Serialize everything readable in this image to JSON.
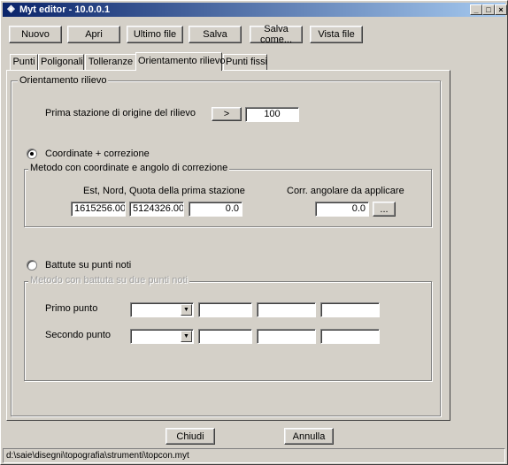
{
  "window": {
    "title": "Myt editor - 10.0.0.1"
  },
  "titlebar": {
    "minimize": "_",
    "maximize": "□",
    "close": "×"
  },
  "toolbar": {
    "new_label": "Nuovo",
    "open_label": "Apri",
    "last_file_label": "Ultimo file",
    "save_label": "Salva",
    "save_as_label": "Salva come...",
    "view_file_label": "Vista file"
  },
  "tabs": [
    {
      "label": "Punti"
    },
    {
      "label": "Poligonali"
    },
    {
      "label": "Tolleranze"
    },
    {
      "label": "Orientamento rilievo"
    },
    {
      "label": "Punti fissi"
    }
  ],
  "orientation": {
    "group_title": "Orientamento rilievo",
    "origin_station_label": "Prima stazione di origine del rilievo",
    "arrow_button": ">",
    "origin_station_value": "100",
    "coords": {
      "radio_label": "Coordinate + correzione",
      "selected": true,
      "group_title": "Metodo con coordinate e angolo di correzione",
      "coords_label": "Est, Nord, Quota della prima stazione",
      "east": "1615256.00",
      "north": "5124326.00",
      "elevation": "0.0",
      "corr_label": "Corr. angolare da applicare",
      "corr_value": "0.0",
      "corr_button": "..."
    },
    "points": {
      "radio_label": "Battute su punti noti",
      "selected": false,
      "group_title": "Metodo con battuta su due punti noti",
      "first_point_label": "Primo punto",
      "second_point_label": "Secondo punto"
    }
  },
  "footer": {
    "close_label": "Chiudi",
    "cancel_label": "Annulla",
    "status_path": "d:\\saie\\disegni\\topografia\\strumenti\\topcon.myt"
  },
  "colors": {
    "face": "#d4d0c8",
    "title_start": "#0a246a",
    "title_end": "#a6caf0"
  }
}
